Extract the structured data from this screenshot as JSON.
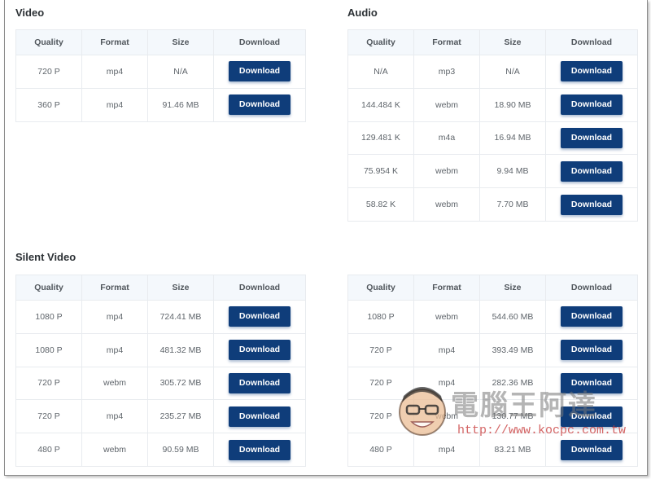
{
  "sections": {
    "video": {
      "title": "Video"
    },
    "audio": {
      "title": "Audio"
    },
    "silent": {
      "title": "Silent Video"
    }
  },
  "headers": {
    "quality": "Quality",
    "format": "Format",
    "size": "Size",
    "download": "Download"
  },
  "button_label": "Download",
  "video_rows": [
    {
      "quality": "720 P",
      "format": "mp4",
      "size": "N/A"
    },
    {
      "quality": "360 P",
      "format": "mp4",
      "size": "91.46 MB"
    }
  ],
  "audio_rows": [
    {
      "quality": "N/A",
      "format": "mp3",
      "size": "N/A"
    },
    {
      "quality": "144.484 K",
      "format": "webm",
      "size": "18.90 MB"
    },
    {
      "quality": "129.481 K",
      "format": "m4a",
      "size": "16.94 MB"
    },
    {
      "quality": "75.954 K",
      "format": "webm",
      "size": "9.94 MB"
    },
    {
      "quality": "58.82 K",
      "format": "webm",
      "size": "7.70 MB"
    }
  ],
  "silent_left_rows": [
    {
      "quality": "1080 P",
      "format": "mp4",
      "size": "724.41 MB"
    },
    {
      "quality": "1080 P",
      "format": "mp4",
      "size": "481.32 MB"
    },
    {
      "quality": "720 P",
      "format": "webm",
      "size": "305.72 MB"
    },
    {
      "quality": "720 P",
      "format": "mp4",
      "size": "235.27 MB"
    },
    {
      "quality": "480 P",
      "format": "webm",
      "size": "90.59 MB"
    }
  ],
  "silent_right_rows": [
    {
      "quality": "1080 P",
      "format": "webm",
      "size": "544.60 MB"
    },
    {
      "quality": "720 P",
      "format": "mp4",
      "size": "393.49 MB"
    },
    {
      "quality": "720 P",
      "format": "mp4",
      "size": "282.36 MB"
    },
    {
      "quality": "720 P",
      "format": "webm",
      "size": "130.77 MB"
    },
    {
      "quality": "480 P",
      "format": "mp4",
      "size": "83.21 MB"
    }
  ],
  "watermark": {
    "text": "電腦王阿達",
    "url": "http://www.kocpc.com.tw"
  },
  "colors": {
    "button": "#0f3d7a",
    "header_bg": "#f4f8fc"
  }
}
